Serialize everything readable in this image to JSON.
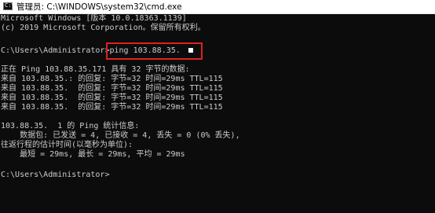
{
  "window": {
    "title": "管理员: C:\\WINDOWS\\system32\\cmd.exe",
    "icon": "cmd-icon"
  },
  "console": {
    "lines": [
      "Microsoft Windows [版本 10.0.18363.1139]",
      "(c) 2019 Microsoft Corporation。保留所有权利。",
      "",
      "C:\\Users\\Administrator>ping 103.88.35.",
      "",
      "正在 Ping 103.88.35.171 具有 32 字节的数据:",
      "来自 103.88.35.: 的回复: 字节=32 时间=29ms TTL=115",
      "来自 103.88.35.  的回复: 字节=32 时间=29ms TTL=115",
      "来自 103.88.35.  的回复: 字节=32 时间=29ms TTL=115",
      "来自 103.88.35.  的回复: 字节=32 时间=29ms TTL=115",
      "",
      "103.88.35.  1 的 Ping 统计信息:",
      "    数据包: 已发送 = 4, 已接收 = 4, 丢失 = 0 (0% 丢失),",
      "往返行程的估计时间(以毫秒为单位):",
      "    最短 = 29ms, 最长 = 29ms, 平均 = 29ms",
      "",
      "C:\\Users\\Administrator>"
    ],
    "highlighted_command": "ping 103.88.35.",
    "highlight_color": "#e02020",
    "text_color": "#cccccc",
    "background_color": "#0c0c0c"
  }
}
